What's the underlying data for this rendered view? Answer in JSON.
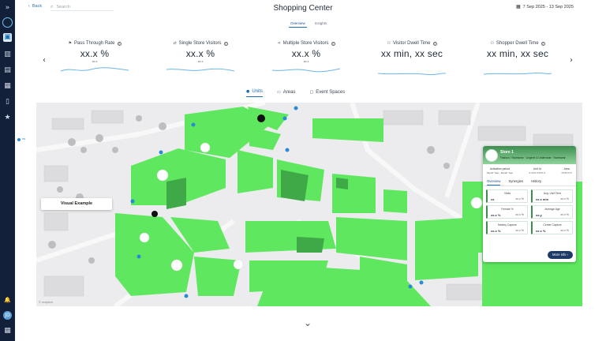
{
  "sidebar": {
    "items": [
      {
        "icon": "expand-icon",
        "glyph": "»"
      },
      {
        "icon": "logo-icon",
        "glyph": ""
      },
      {
        "icon": "venue-icon",
        "glyph": "▣"
      },
      {
        "icon": "building-icon",
        "glyph": "▥"
      },
      {
        "icon": "store-icon",
        "glyph": "▤"
      },
      {
        "icon": "layout-icon",
        "glyph": "▦"
      },
      {
        "icon": "mobile-icon",
        "glyph": "▯"
      },
      {
        "icon": "star-icon",
        "glyph": "★"
      }
    ],
    "bottom": [
      {
        "icon": "bell-icon",
        "glyph": "🔔"
      },
      {
        "icon": "avatar-icon",
        "glyph": "JD"
      },
      {
        "icon": "apps-icon",
        "glyph": "▦"
      }
    ],
    "side_dot_label": "ns"
  },
  "header": {
    "back_label": "Back",
    "search_placeholder": "Search",
    "title": "Shopping Center",
    "date_range": "7 Sep 2025 - 13 Sep 2025",
    "tabs": [
      {
        "label": "Overview",
        "active": true
      },
      {
        "label": "Insights",
        "active": false
      }
    ]
  },
  "kpis": [
    {
      "title": "Pass Through Rate",
      "value": "xx.x %",
      "sub": "xx.x",
      "icon": "walk-icon",
      "glyph": "⚑"
    },
    {
      "title": "Single Store Visitors",
      "value": "xx.x %",
      "sub": "xx.x",
      "icon": "arrows-icon",
      "glyph": "⇄"
    },
    {
      "title": "Multiple Store Visitors",
      "value": "xx.x %",
      "sub": "xx.x",
      "icon": "share-icon",
      "glyph": "⋖"
    },
    {
      "title": "Visitor Dwell Time",
      "value": "xx min, xx sec",
      "sub": "",
      "icon": "visitor-icon",
      "glyph": "⚇"
    },
    {
      "title": "Shopper Dwell Time",
      "value": "xx min, xx sec",
      "sub": "",
      "icon": "shopper-icon",
      "glyph": "⚇"
    }
  ],
  "map_tabs": [
    {
      "label": "Units",
      "icon": "pin-icon",
      "glyph": "●",
      "active": true
    },
    {
      "label": "Areas",
      "icon": "areas-icon",
      "glyph": "▭",
      "active": false
    },
    {
      "label": "Event Spaces",
      "icon": "event-icon",
      "glyph": "▢",
      "active": false
    }
  ],
  "map": {
    "overlay_label": "Visual Example",
    "attribution": "© mapbox",
    "unit_color": "#5fe85f",
    "unit_dark_color": "#3fa948"
  },
  "store_card": {
    "name": "Store 1",
    "category": "Fashion / Swimwear · Lingerie & Underwear · Swimwear",
    "meta": [
      {
        "label": "Activation period",
        "value": "Month Year - Month Year"
      },
      {
        "label": "Unit Id",
        "value": "X-XXX-XXXX-X"
      },
      {
        "label": "Area",
        "value": "XXXX FT²"
      }
    ],
    "tabs": [
      {
        "label": "Overview",
        "active": true
      },
      {
        "label": "Synergies",
        "active": false
      },
      {
        "label": "History",
        "active": false
      }
    ],
    "metrics": [
      {
        "label": "Visits",
        "value": "xx",
        "sub": "xx.x %"
      },
      {
        "label": "Avg. Visit Time",
        "value": "xx.x min",
        "sub": "xx.x %"
      },
      {
        "label": "Female %",
        "value": "xx.x %",
        "sub": "xx.x %"
      },
      {
        "label": "Average Age",
        "value": "xx.y",
        "sub": "xx.x %"
      },
      {
        "label": "Nearby Capture",
        "value": "xx.x %",
        "sub": "xx.x %"
      },
      {
        "label": "Center Capture",
        "value": "xx.x %",
        "sub": "xx.x %"
      }
    ],
    "more_label": "More info ›"
  }
}
